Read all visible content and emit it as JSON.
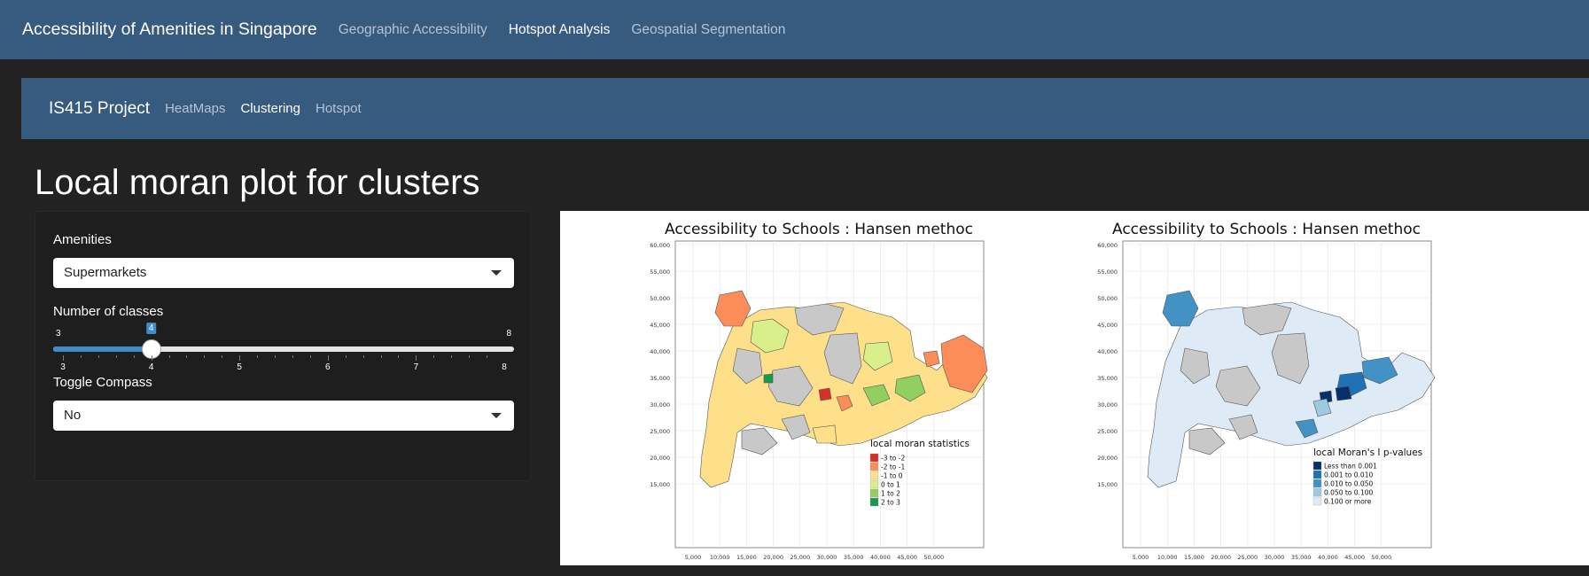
{
  "topnav": {
    "brand": "Accessibility of Amenities in Singapore",
    "links": [
      {
        "label": "Geographic Accessibility"
      },
      {
        "label": "Hotspot Analysis"
      },
      {
        "label": "Geospatial Segmentation"
      }
    ]
  },
  "subnav": {
    "brand": "IS415 Project",
    "links": [
      {
        "label": "HeatMaps"
      },
      {
        "label": "Clustering"
      },
      {
        "label": "Hotspot"
      }
    ]
  },
  "page_title": "Local moran plot for clusters",
  "sidebar": {
    "amenities_label": "Amenities",
    "amenities_value": "Supermarkets",
    "classes_label": "Number of classes",
    "slider": {
      "min": 3,
      "max": 8,
      "value": 4,
      "min_label": "3",
      "max_label": "8",
      "value_label": "4",
      "ticks": [
        "3",
        "4",
        "5",
        "6",
        "7",
        "8"
      ]
    },
    "compass_label": "Toggle Compass",
    "compass_value": "No"
  },
  "maps": {
    "left": {
      "title": "Accessibility to Schools :  Hansen methoc",
      "legend_title": "local moran statistics",
      "legend": [
        {
          "label": "-3 to -2",
          "color": "#d73027"
        },
        {
          "label": "-2 to -1",
          "color": "#fc8d59"
        },
        {
          "label": "-1 to 0",
          "color": "#fee08b"
        },
        {
          "label": "0 to 1",
          "color": "#d9ef8b"
        },
        {
          "label": "1 to 2",
          "color": "#91cf60"
        },
        {
          "label": "2 to 3",
          "color": "#1a9850"
        }
      ]
    },
    "right": {
      "title": "Accessibility to Schools :  Hansen methoc",
      "legend_title": "local Moran's I p-values",
      "legend": [
        {
          "label": "Less than 0.001",
          "color": "#08306b"
        },
        {
          "label": "0.001 to 0.010",
          "color": "#2171b5"
        },
        {
          "label": "0.010 to 0.050",
          "color": "#4292c6"
        },
        {
          "label": "0.050 to 0.100",
          "color": "#9ecae1"
        },
        {
          "label": "0.100 or more",
          "color": "#deebf7"
        }
      ]
    },
    "y_ticks": [
      "60,000",
      "55,000",
      "50,000",
      "45,000",
      "40,000",
      "35,000",
      "30,000",
      "25,000",
      "20,000",
      "15,000"
    ],
    "x_ticks": [
      "5,000",
      "10,000",
      "15,000",
      "20,000",
      "25,000",
      "30,000",
      "35,000",
      "40,000",
      "45,000",
      "50,000"
    ]
  }
}
